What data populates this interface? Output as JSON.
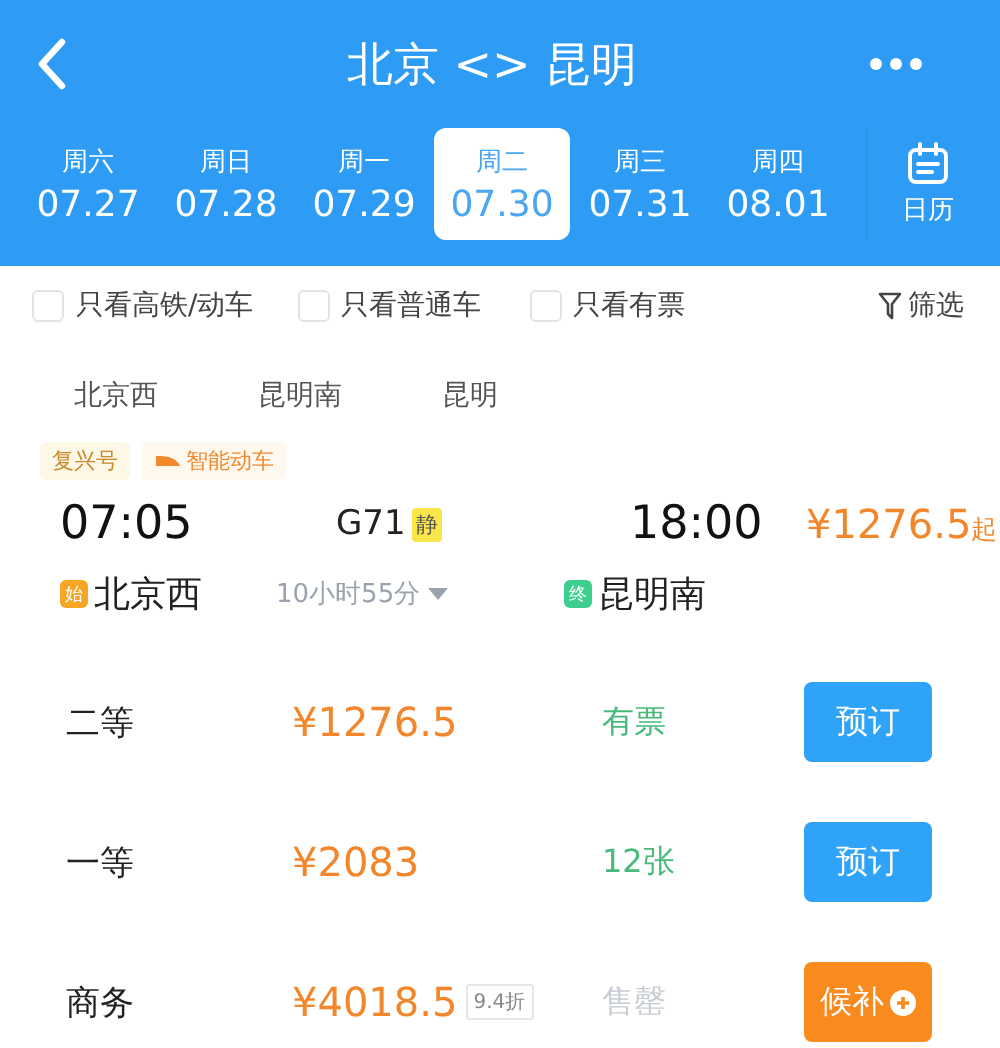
{
  "header": {
    "title": "北京 <> 昆明"
  },
  "dates": [
    {
      "weekday": "周六",
      "date": "07.27",
      "selected": false
    },
    {
      "weekday": "周日",
      "date": "07.28",
      "selected": false
    },
    {
      "weekday": "周一",
      "date": "07.29",
      "selected": false
    },
    {
      "weekday": "周二",
      "date": "07.30",
      "selected": true
    },
    {
      "weekday": "周三",
      "date": "07.31",
      "selected": false
    },
    {
      "weekday": "周四",
      "date": "08.01",
      "selected": false
    }
  ],
  "calendar_label": "日历",
  "filters": [
    {
      "label": "只看高铁/动车",
      "checked": false
    },
    {
      "label": "只看普通车",
      "checked": false
    },
    {
      "label": "只看有票",
      "checked": false
    }
  ],
  "filter_button": "筛选",
  "stations": [
    "北京西",
    "昆明南",
    "昆明"
  ],
  "train": {
    "tags": [
      "复兴号",
      "智能动车"
    ],
    "depart_time": "07:05",
    "train_no": "G71",
    "quiet_badge": "静",
    "arrive_time": "18:00",
    "price": "¥1276.5",
    "price_suffix": "起",
    "start_badge": "始",
    "depart_station": "北京西",
    "duration": "10小时55分",
    "end_badge": "终",
    "arrive_station": "昆明南"
  },
  "seats": [
    {
      "class": "二等",
      "price": "¥1276.5",
      "availability": "有票",
      "available": true,
      "action": "预订",
      "kind": "book"
    },
    {
      "class": "一等",
      "price": "¥2083",
      "availability": "12张",
      "available": true,
      "action": "预订",
      "kind": "book"
    },
    {
      "class": "商务",
      "price": "¥4018.5",
      "discount": "9.4折",
      "availability": "售罄",
      "available": false,
      "action": "候补",
      "kind": "waitlist"
    }
  ]
}
